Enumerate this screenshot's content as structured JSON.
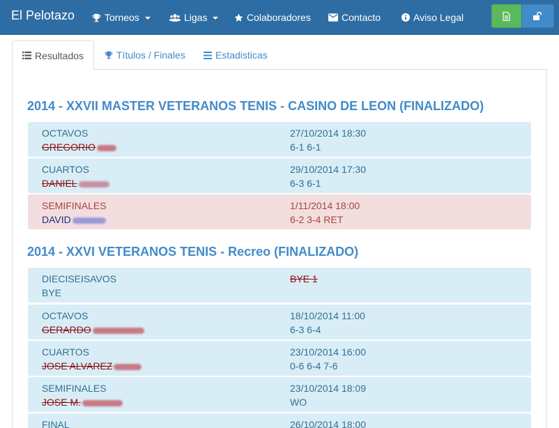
{
  "navbar": {
    "brand": "El Pelotazo",
    "items": [
      {
        "label": "Torneos",
        "icon": "trophy-icon",
        "dropdown": true
      },
      {
        "label": "Ligas",
        "icon": "users-icon",
        "dropdown": true
      },
      {
        "label": "Colaboradores",
        "icon": "star-icon",
        "dropdown": false
      },
      {
        "label": "Contacto",
        "icon": "envelope-icon",
        "dropdown": false
      },
      {
        "label": "Aviso Legal",
        "icon": "info-circle-icon",
        "dropdown": false
      }
    ],
    "buttons": [
      {
        "icon": "document-icon",
        "color": "#5cb85c"
      },
      {
        "icon": "unlock-icon",
        "color": "#428bca"
      }
    ]
  },
  "tabs": [
    {
      "label": "Resultados",
      "icon": "list-icon",
      "active": true
    },
    {
      "label": "Títulos / Finales",
      "icon": "trophy-icon",
      "active": false
    },
    {
      "label": "Estadisticas",
      "icon": "bars-icon",
      "active": false
    }
  ],
  "colors": {
    "navbar": "#2e6da4",
    "accent": "#428bca",
    "info_row": "#d9edf7",
    "danger_row": "#f2dede"
  },
  "tournaments": [
    {
      "title": "2014 - XXVII MASTER VETERANOS TENIS - CASINO DE LEON (FINALIZADO)",
      "matches": [
        {
          "round": "OCTAVOS",
          "player": "GREGORIO",
          "date": "27/10/2014 18:30",
          "score": "6-1 6-1",
          "status": "lost"
        },
        {
          "round": "CUARTOS",
          "player": "DANIEL",
          "date": "29/10/2014 17:30",
          "score": "6-3 6-1",
          "status": "lost"
        },
        {
          "round": "SEMIFINALES",
          "player": "DAVID",
          "date": "1/11/2014 18:00",
          "score": "6-2 3-4 RET",
          "status": "won"
        }
      ]
    },
    {
      "title": "2014 - XXVI VETERANOS TENIS - Recreo (FINALIZADO)",
      "matches": [
        {
          "round": "DIECISEISAVOS",
          "player": "BYE",
          "date": "BYE 1",
          "score": "",
          "status": "bye"
        },
        {
          "round": "OCTAVOS",
          "player": "GERARDO",
          "date": "18/10/2014 11:00",
          "score": "6-3 6-4",
          "status": "lost"
        },
        {
          "round": "CUARTOS",
          "player": "JOSE ALVAREZ",
          "date": "23/10/2014 16:00",
          "score": "0-6 6-4 7-6",
          "status": "lost"
        },
        {
          "round": "SEMIFINALES",
          "player": "JOSE M.",
          "date": "23/10/2014 18:09",
          "score": "WO",
          "status": "lost"
        },
        {
          "round": "FINAL",
          "player": "",
          "date": "26/10/2014 18:00",
          "score": "",
          "status": "lost"
        }
      ]
    }
  ]
}
